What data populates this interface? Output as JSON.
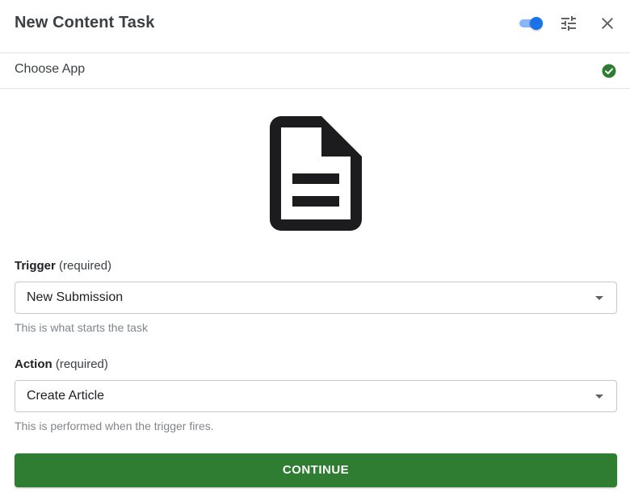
{
  "header": {
    "title": "New Content Task",
    "toggle_on": true,
    "toggle_icon": "toggle-switch-icon",
    "settings_icon": "tune-icon",
    "close_icon": "close-icon"
  },
  "choose_app": {
    "label": "Choose App",
    "status_icon": "check-circle-icon",
    "status_color": "#2e7d32"
  },
  "app_icon": "document-icon",
  "trigger": {
    "label": "Trigger",
    "required_text": "(required)",
    "value": "New Submission",
    "hint": "This is what starts the task"
  },
  "action": {
    "label": "Action",
    "required_text": "(required)",
    "value": "Create Article",
    "hint": "This is performed when the trigger fires."
  },
  "continue_label": "CONTINUE",
  "colors": {
    "accent": "#1a73e8",
    "primary_button": "#2e7d32"
  }
}
